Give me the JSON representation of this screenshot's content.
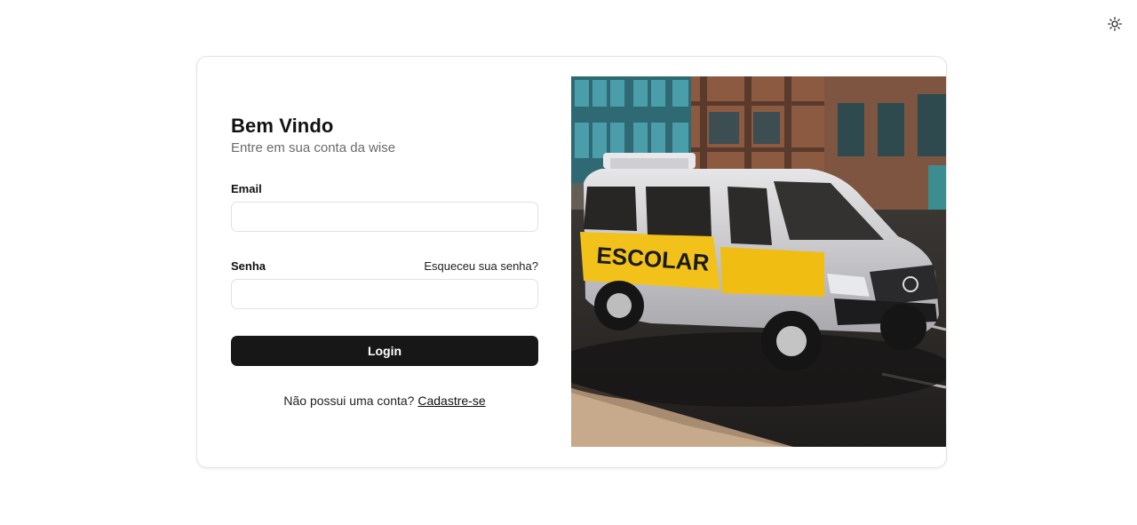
{
  "theme_toggle": {
    "icon": "sun-icon"
  },
  "login": {
    "title": "Bem Vindo",
    "subtitle": "Entre em sua conta da wise",
    "email_label": "Email",
    "email_value": "",
    "email_placeholder": "",
    "password_label": "Senha",
    "password_value": "",
    "password_placeholder": "",
    "forgot_password": "Esqueceu sua senha?",
    "submit_label": "Login",
    "no_account_text": "Não possui uma conta?",
    "signup_link": "Cadastre-se"
  },
  "hero": {
    "van_text": "ESCOLAR",
    "colors": {
      "van_body": "#c9c9cc",
      "stripe": "#f2c21a",
      "asphalt": "#2c2a28"
    }
  }
}
